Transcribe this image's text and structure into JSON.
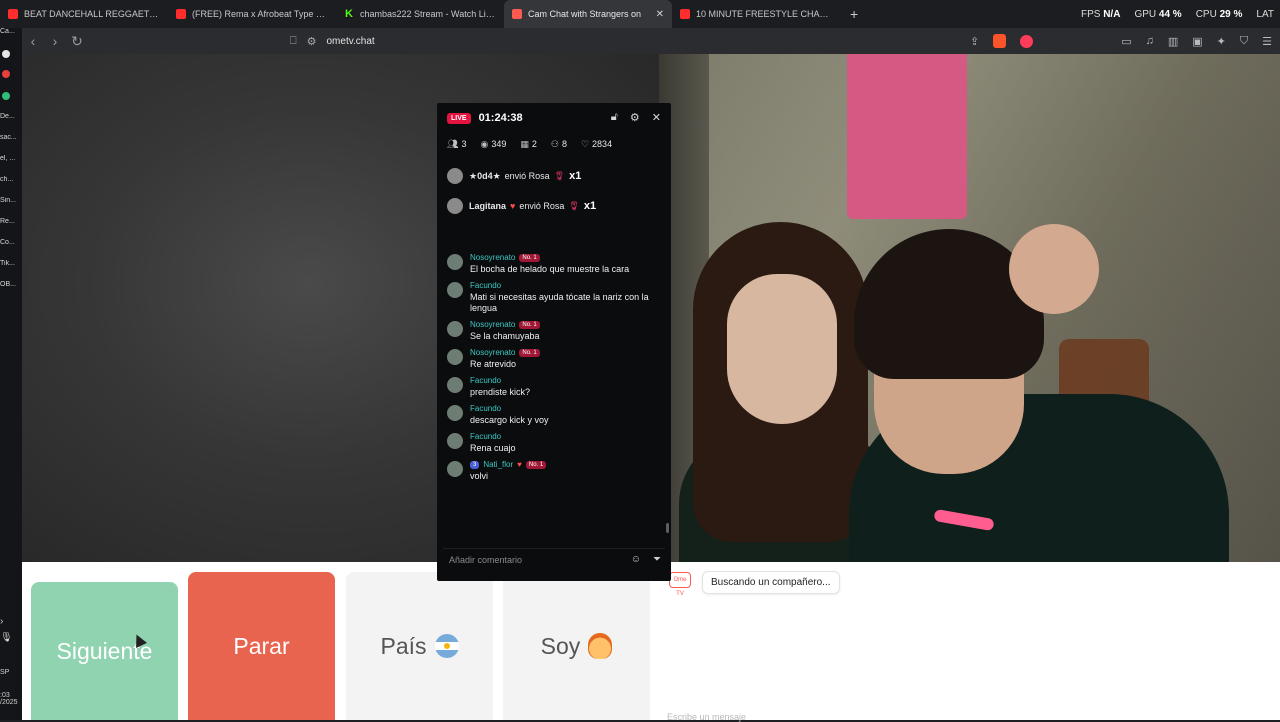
{
  "browser": {
    "tabs": [
      {
        "label": "BEAT DANCEHALL REGGAETON | Pist",
        "favicon": "youtube-icon",
        "active": false
      },
      {
        "label": "(FREE) Rema x Afrobeat Type Beat - \"",
        "favicon": "youtube-icon",
        "active": false
      },
      {
        "label": "chambas222 Stream - Watch Live on",
        "favicon": "kick-icon",
        "active": false
      },
      {
        "label": "Cam Chat with Strangers on",
        "favicon": "ometv-icon",
        "active": true
      },
      {
        "label": "10 MINUTE FREESTYLE CHALLENGE!",
        "favicon": "youtube-icon",
        "active": false
      }
    ],
    "new_tab": "+",
    "url": "ometv.chat",
    "stats": {
      "fps_label": "FPS",
      "fps_value": "N/A",
      "gpu_label": "GPU",
      "gpu_value": "44 %",
      "cpu_label": "CPU",
      "cpu_value": "29 %",
      "extra_label": "LAT"
    }
  },
  "sidebar": {
    "items": [
      "Ca...",
      "De...",
      "sac...",
      "el, ...",
      "ch...",
      "Sin...",
      "Re...",
      "Co...",
      "Tik...",
      "OB..."
    ],
    "footer": [
      "SP",
      ":03",
      "/2025"
    ]
  },
  "overlay": {
    "live_label": "LIVE",
    "timer": "01:24:38",
    "stats": {
      "users": "3",
      "views": "349",
      "gifts": "2",
      "followers": "8",
      "likes": "2834"
    },
    "gifts": [
      {
        "user": "★0d4★",
        "action": "envió Rosa",
        "mult": "x1"
      },
      {
        "user": "Lagitana",
        "action": "envió Rosa",
        "mult": "x1"
      }
    ],
    "messages": [
      {
        "user": "Nosoyrenato",
        "badge": "No. 1",
        "text": "El bocha de helado que muestre la cara"
      },
      {
        "user": "Facundo",
        "badge": "",
        "text": "Mati si necesitas ayuda tócate la nariz con la lengua"
      },
      {
        "user": "Nosoyrenato",
        "badge": "No. 1",
        "text": "Se la chamuyaba"
      },
      {
        "user": "Nosoyrenato",
        "badge": "No. 1",
        "text": "Re atrevido"
      },
      {
        "user": "Facundo",
        "badge": "",
        "text": "prendiste kick?"
      },
      {
        "user": "Facundo",
        "badge": "",
        "text": "descargo kick y voy"
      },
      {
        "user": "Facundo",
        "badge": "",
        "text": "Rena cuajo"
      },
      {
        "user": "Nati_flor",
        "badge": "No. 1",
        "level": "3",
        "text": "volvi"
      }
    ],
    "input_placeholder": "Añadir comentario"
  },
  "controls": {
    "next": "Siguiente",
    "stop": "Parar",
    "country": "País",
    "gender": "Soy"
  },
  "textchat": {
    "logo": "Ome TV",
    "status": "Buscando un compañero...",
    "input_placeholder": "Escribe un mensaje"
  },
  "colors": {
    "next": "#8fd3b0",
    "stop": "#e9644f",
    "neutral": "#f3f3f3",
    "live": "#e4133f",
    "chat_user": "#3cc7c2"
  }
}
